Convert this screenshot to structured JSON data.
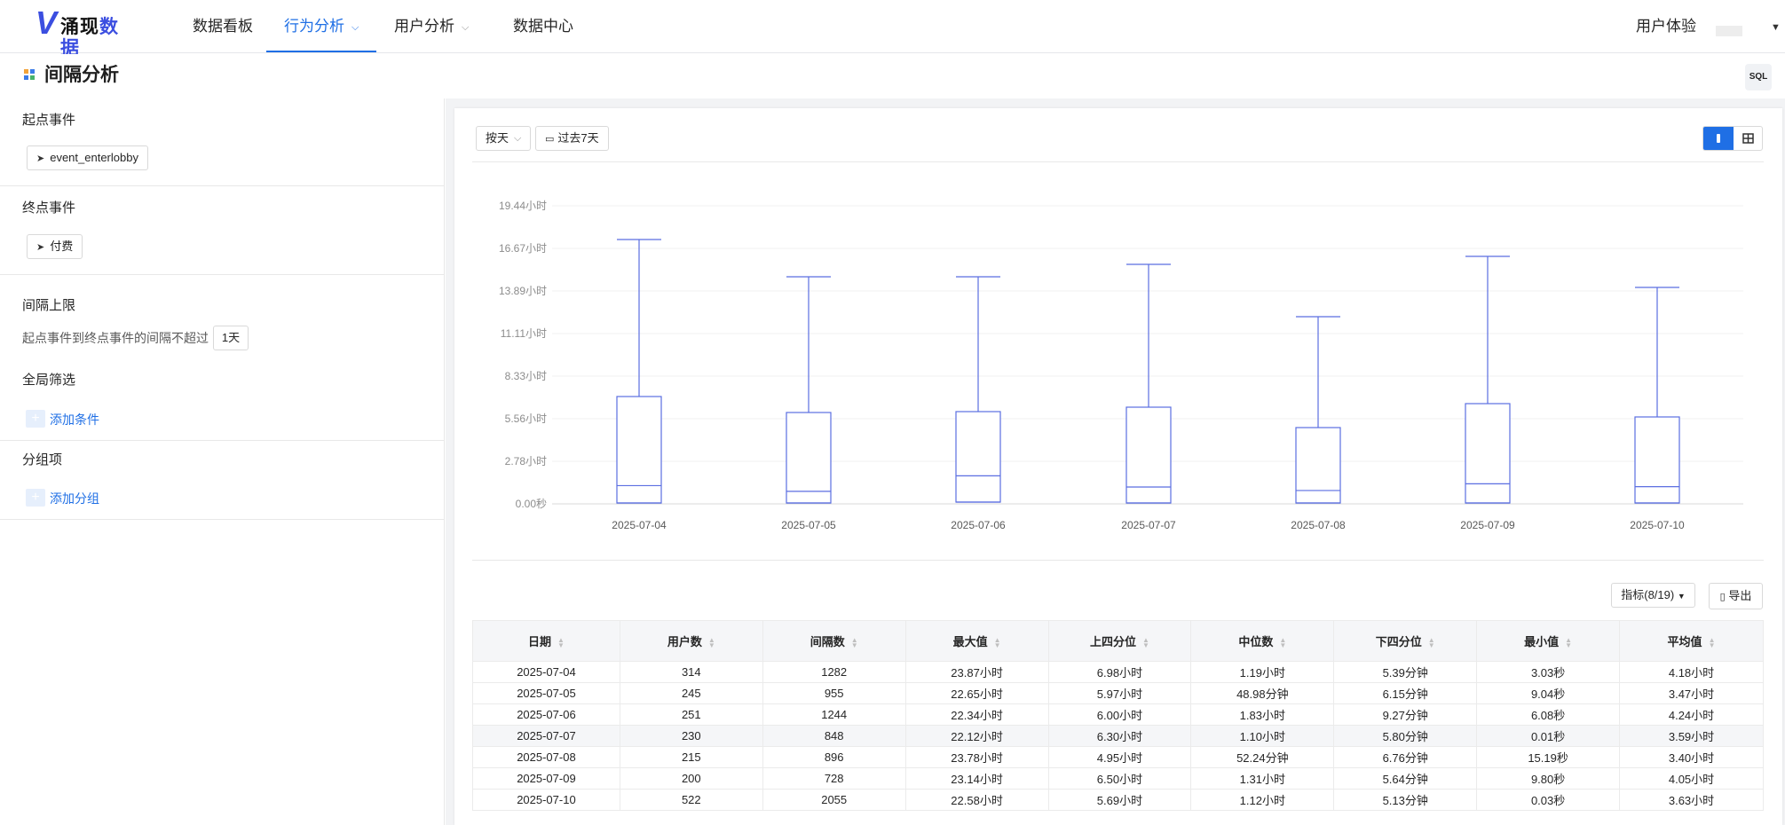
{
  "app": {
    "logo_text_1": "涌现",
    "logo_text_2": "数据"
  },
  "nav": {
    "items": [
      {
        "label": "数据看板",
        "active": false
      },
      {
        "label": "行为分析",
        "active": true
      },
      {
        "label": "用户分析",
        "active": false
      },
      {
        "label": "数据中心",
        "active": false
      }
    ],
    "user_experience": "用户体验"
  },
  "page": {
    "title": "间隔分析",
    "sql_button": "SQL"
  },
  "sidebar": {
    "start_event_label": "起点事件",
    "start_event": "event_enterlobby",
    "end_event_label": "终点事件",
    "end_event": "付费",
    "interval_limit_label": "间隔上限",
    "interval_limit_text": "起点事件到终点事件的间隔不超过",
    "interval_limit_value": "1天",
    "global_filter_label": "全局筛选",
    "add_condition": "添加条件",
    "group_label": "分组项",
    "add_group": "添加分组"
  },
  "controls": {
    "granularity": "按天",
    "date_range": "过去7天",
    "metrics": "指标(8/19)",
    "export": "导出"
  },
  "colors": {
    "accent": "#1f6fe5",
    "box_stroke": "#5b6ee1",
    "grid": "#f0f0f0"
  },
  "chart_data": {
    "type": "box",
    "categories": [
      "2025-07-04",
      "2025-07-05",
      "2025-07-06",
      "2025-07-07",
      "2025-07-08",
      "2025-07-09",
      "2025-07-10"
    ],
    "y_ticks": [
      "0.00秒",
      "2.78小时",
      "5.56小时",
      "8.33小时",
      "11.11小时",
      "13.89小时",
      "16.67小时",
      "19.44小时"
    ],
    "y_unit": "hours",
    "ylim": [
      0,
      19.44
    ],
    "series": [
      {
        "q3": 6.98,
        "median": 1.19,
        "q1": 0.0898
      },
      {
        "q3": 5.97,
        "median": 0.8163,
        "q1": 0.1025
      },
      {
        "q3": 6.0,
        "median": 1.83,
        "q1": 0.1545
      },
      {
        "q3": 6.3,
        "median": 1.1,
        "q1": 0.0967
      },
      {
        "q3": 4.95,
        "median": 0.8707,
        "q1": 0.1127
      },
      {
        "q3": 6.5,
        "median": 1.31,
        "q1": 0.094
      },
      {
        "q3": 5.69,
        "median": 1.12,
        "q1": 0.0855
      }
    ],
    "grid": true
  },
  "table": {
    "headers": [
      "日期",
      "用户数",
      "间隔数",
      "最大值",
      "上四分位",
      "中位数",
      "下四分位",
      "最小值",
      "平均值"
    ],
    "rows": [
      [
        "2025-07-04",
        "314",
        "1282",
        "23.87小时",
        "6.98小时",
        "1.19小时",
        "5.39分钟",
        "3.03秒",
        "4.18小时"
      ],
      [
        "2025-07-05",
        "245",
        "955",
        "22.65小时",
        "5.97小时",
        "48.98分钟",
        "6.15分钟",
        "9.04秒",
        "3.47小时"
      ],
      [
        "2025-07-06",
        "251",
        "1244",
        "22.34小时",
        "6.00小时",
        "1.83小时",
        "9.27分钟",
        "6.08秒",
        "4.24小时"
      ],
      [
        "2025-07-07",
        "230",
        "848",
        "22.12小时",
        "6.30小时",
        "1.10小时",
        "5.80分钟",
        "0.01秒",
        "3.59小时"
      ],
      [
        "2025-07-08",
        "215",
        "896",
        "23.78小时",
        "4.95小时",
        "52.24分钟",
        "6.76分钟",
        "15.19秒",
        "3.40小时"
      ],
      [
        "2025-07-09",
        "200",
        "728",
        "23.14小时",
        "6.50小时",
        "1.31小时",
        "5.64分钟",
        "9.80秒",
        "4.05小时"
      ],
      [
        "2025-07-10",
        "522",
        "2055",
        "22.58小时",
        "5.69小时",
        "1.12小时",
        "5.13分钟",
        "0.03秒",
        "3.63小时"
      ]
    ]
  }
}
